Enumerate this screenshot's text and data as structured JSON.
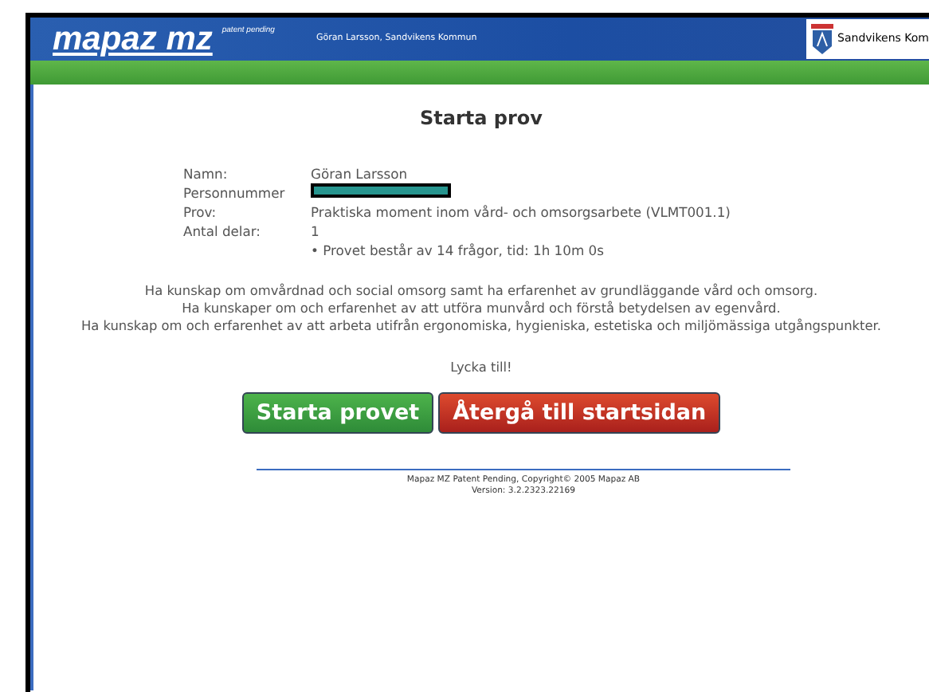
{
  "header": {
    "logo": "mapaz mz",
    "logo_tagline": "patent pending",
    "user": "Göran Larsson, Sandvikens Kommun",
    "organization": "Sandvikens Kom"
  },
  "title": "Starta prov",
  "details": [
    {
      "label": "Namn:",
      "value": "Göran Larsson",
      "kind": "text"
    },
    {
      "label": "Personnummer",
      "kind": "redacted"
    },
    {
      "label": "Prov:",
      "value": "Praktiska moment inom vård- och omsorgsarbete (VLMT001.1)",
      "kind": "text"
    },
    {
      "label": "Antal delar:",
      "value": "1",
      "kind": "text"
    },
    {
      "value": "• Provet består av 14 frågor, tid: 1h 10m 0s",
      "kind": "note"
    }
  ],
  "description": [
    "Ha kunskap om omvårdnad och social omsorg samt ha erfarenhet av grundläggande vård och omsorg.",
    "Ha kunskaper om och erfarenhet av att utföra munvård och förstå betydelsen av egenvård.",
    "Ha kunskap om och erfarenhet av att arbeta utifrån ergonomiska, hygieniska, estetiska och miljömässiga utgångspunkter."
  ],
  "greeting": "Lycka till!",
  "buttons": [
    {
      "label": "Starta provet",
      "kind": "start"
    },
    {
      "label": "Återgå till startsidan",
      "kind": "back"
    }
  ],
  "footer": [
    "Mapaz MZ Patent Pending, Copyright© 2005 Mapaz AB",
    "Version: 3.2.2323.22169"
  ]
}
